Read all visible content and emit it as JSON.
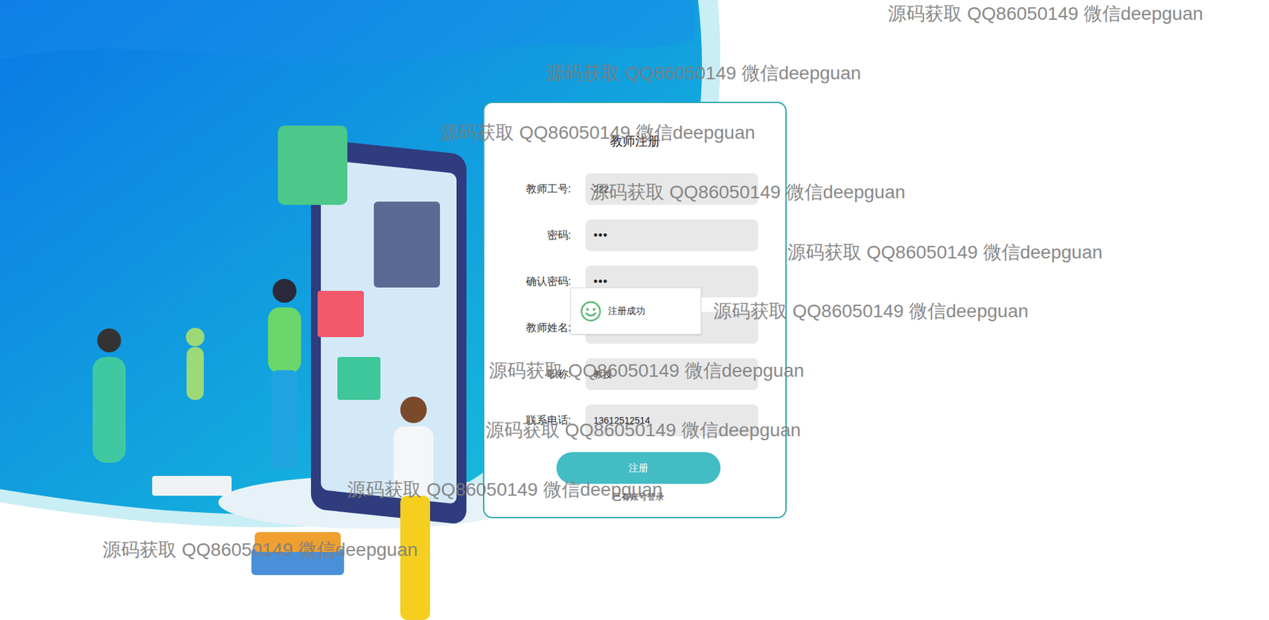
{
  "page": {
    "title": "教师注册"
  },
  "fields": [
    {
      "label": "教师工号:",
      "value": "222",
      "kind": "text"
    },
    {
      "label": "密码:",
      "value": "•••",
      "kind": "password"
    },
    {
      "label": "确认密码:",
      "value": "•••",
      "kind": "password"
    },
    {
      "label": "教师姓名:",
      "value": "",
      "kind": "text"
    },
    {
      "label": "职称:",
      "value": "教授",
      "kind": "text"
    },
    {
      "label": "联系电话:",
      "value": "13612512514",
      "kind": "text"
    }
  ],
  "submit_button": "注册",
  "login_link": "已有账号登录",
  "toast": {
    "text": "注册成功"
  },
  "watermarks": [
    {
      "text": "源码获取 QQ86050149 微信deepguan"
    },
    {
      "text": "源码获取 QQ86050149 微信deepguan"
    },
    {
      "text": "源码获取 QQ86050149 微信deepguan"
    },
    {
      "text": "源码获取 QQ86050149 微信deepguan"
    },
    {
      "text": "源码获取 QQ86050149 微信deepguan"
    },
    {
      "text": "源码获取 QQ86050149 微信deepguan"
    },
    {
      "text": "源码获取 QQ86050149 微信deepguan"
    },
    {
      "text": "源码获取 QQ86050149 微信deepguan"
    },
    {
      "text": "源码获取 QQ86050149 微信deepguan"
    },
    {
      "text": "源码获取 QQ86050149 微信deepguan"
    }
  ]
}
